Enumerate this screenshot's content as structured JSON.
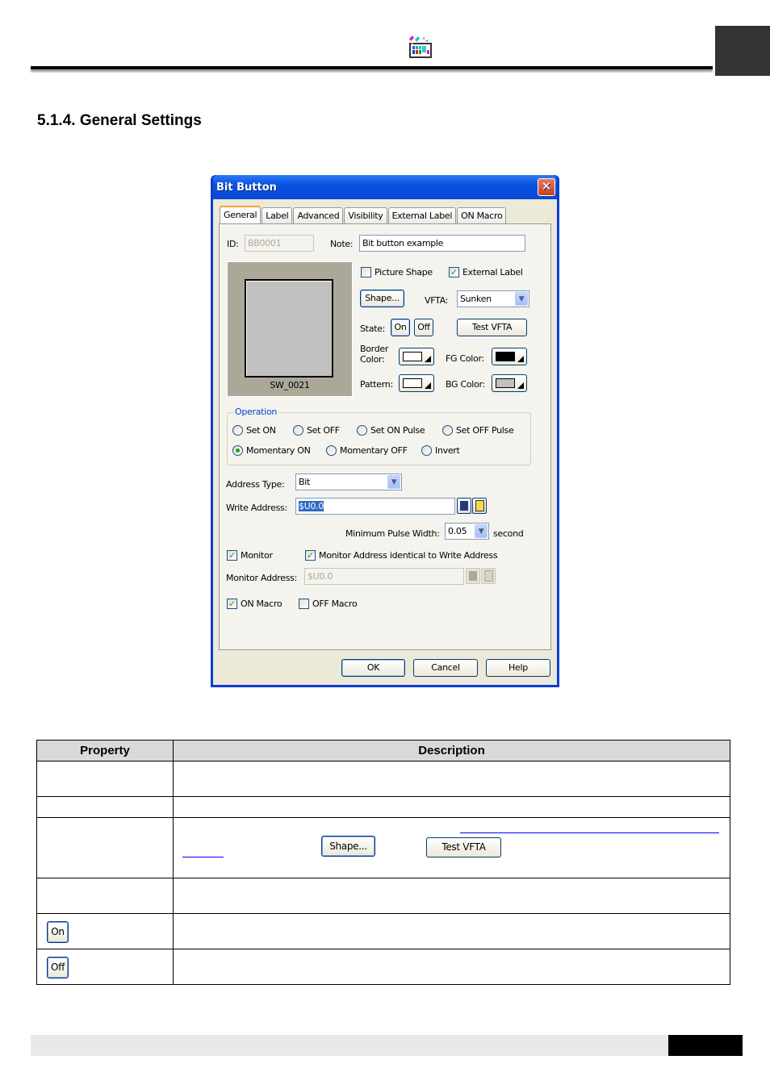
{
  "header": {
    "logo_icon": "app-logo-icon"
  },
  "section_title": "5.1.4. General Settings",
  "dialog": {
    "title": "Bit Button",
    "close_glyph": "✕",
    "tabs": [
      {
        "label": "General",
        "active": true
      },
      {
        "label": "Label",
        "active": false
      },
      {
        "label": "Advanced",
        "active": false
      },
      {
        "label": "Visibility",
        "active": false
      },
      {
        "label": "External Label",
        "active": false
      },
      {
        "label": "ON Macro",
        "active": false
      }
    ],
    "id_label": "ID:",
    "id_value": "BB0001",
    "note_label": "Note:",
    "note_value": "Bit button example",
    "preview_caption": "SW_0021",
    "picture_shape": {
      "label": "Picture Shape",
      "checked": false
    },
    "external_label": {
      "label": "External Label",
      "checked": true
    },
    "shape_button": "Shape...",
    "vfta_label": "VFTA:",
    "vfta_value": "Sunken",
    "state_label": "State:",
    "state_on": "On",
    "state_off": "Off",
    "test_vfta_button": "Test VFTA",
    "border_color_label": "Border Color:",
    "fg_color_label": "FG Color:",
    "pattern_label": "Pattern:",
    "bg_color_label": "BG Color:",
    "colors": {
      "border": "#ffffff",
      "fg": "#000000",
      "pattern": "#ffffff",
      "bg": "#c0c0c0"
    },
    "operation": {
      "title": "Operation",
      "options": [
        {
          "label": "Set ON",
          "selected": false
        },
        {
          "label": "Set OFF",
          "selected": false
        },
        {
          "label": "Set ON Pulse",
          "selected": false
        },
        {
          "label": "Set OFF Pulse",
          "selected": false
        },
        {
          "label": "Momentary ON",
          "selected": true
        },
        {
          "label": "Momentary OFF",
          "selected": false
        },
        {
          "label": "Invert",
          "selected": false
        }
      ]
    },
    "address_type_label": "Address Type:",
    "address_type_value": "Bit",
    "write_address_label": "Write Address:",
    "write_address_value": "$U0.0",
    "min_pulse_label": "Minimum Pulse Width:",
    "min_pulse_value": "0.05",
    "min_pulse_unit": "second",
    "monitor": {
      "label": "Monitor",
      "checked": true
    },
    "monitor_identical": {
      "label": "Monitor Address identical to Write Address",
      "checked": true
    },
    "monitor_address_label": "Monitor Address:",
    "monitor_address_value": "$U0.0",
    "on_macro": {
      "label": "ON Macro",
      "checked": true
    },
    "off_macro": {
      "label": "OFF Macro",
      "checked": false
    },
    "ok_button": "OK",
    "cancel_button": "Cancel",
    "help_button": "Help"
  },
  "table": {
    "headers": [
      "Property",
      "Description"
    ],
    "inline_buttons": {
      "shape": "Shape...",
      "test_vfta": "Test VFTA",
      "on": "On",
      "off": "Off"
    }
  }
}
